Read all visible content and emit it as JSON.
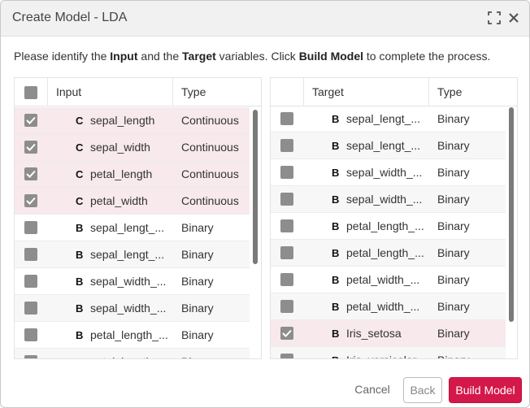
{
  "window": {
    "title": "Create Model - LDA"
  },
  "instruction": {
    "part1": "Please identify the ",
    "input_word": "Input",
    "part2": " and the ",
    "target_word": "Target",
    "part3": " variables. Click ",
    "build_word": "Build Model",
    "part4": " to complete the process."
  },
  "input_table": {
    "header_name": "Input",
    "header_type": "Type",
    "rows": [
      {
        "checked": true,
        "letter": "C",
        "name": "sepal_length",
        "type": "Continuous"
      },
      {
        "checked": true,
        "letter": "C",
        "name": "sepal_width",
        "type": "Continuous"
      },
      {
        "checked": true,
        "letter": "C",
        "name": "petal_length",
        "type": "Continuous"
      },
      {
        "checked": true,
        "letter": "C",
        "name": "petal_width",
        "type": "Continuous"
      },
      {
        "checked": false,
        "letter": "B",
        "name": "sepal_lengt_...",
        "type": "Binary"
      },
      {
        "checked": false,
        "letter": "B",
        "name": "sepal_lengt_...",
        "type": "Binary"
      },
      {
        "checked": false,
        "letter": "B",
        "name": "sepal_width_...",
        "type": "Binary"
      },
      {
        "checked": false,
        "letter": "B",
        "name": "sepal_width_...",
        "type": "Binary"
      },
      {
        "checked": false,
        "letter": "B",
        "name": "petal_length_...",
        "type": "Binary"
      },
      {
        "checked": false,
        "letter": "B",
        "name": "petal_length_...",
        "type": "Bi..."
      }
    ]
  },
  "target_table": {
    "header_name": "Target",
    "header_type": "Type",
    "rows": [
      {
        "checked": false,
        "letter": "B",
        "name": "sepal_lengt_...",
        "type": "Binary"
      },
      {
        "checked": false,
        "letter": "B",
        "name": "sepal_lengt_...",
        "type": "Binary"
      },
      {
        "checked": false,
        "letter": "B",
        "name": "sepal_width_...",
        "type": "Binary"
      },
      {
        "checked": false,
        "letter": "B",
        "name": "sepal_width_...",
        "type": "Binary"
      },
      {
        "checked": false,
        "letter": "B",
        "name": "petal_length_...",
        "type": "Binary"
      },
      {
        "checked": false,
        "letter": "B",
        "name": "petal_length_...",
        "type": "Binary"
      },
      {
        "checked": false,
        "letter": "B",
        "name": "petal_width_...",
        "type": "Binary"
      },
      {
        "checked": false,
        "letter": "B",
        "name": "petal_width_...",
        "type": "Binary"
      },
      {
        "checked": true,
        "letter": "B",
        "name": "Iris_setosa",
        "type": "Binary"
      },
      {
        "checked": false,
        "letter": "B",
        "name": "Iris_versicolor",
        "type": "Binary"
      }
    ]
  },
  "footer": {
    "cancel_label": "Cancel",
    "back_label": "Back",
    "build_label": "Build Model"
  },
  "colors": {
    "accent": "#d4184a",
    "selected_row": "#f7e9ec",
    "checkbox": "#8d8d8d"
  }
}
